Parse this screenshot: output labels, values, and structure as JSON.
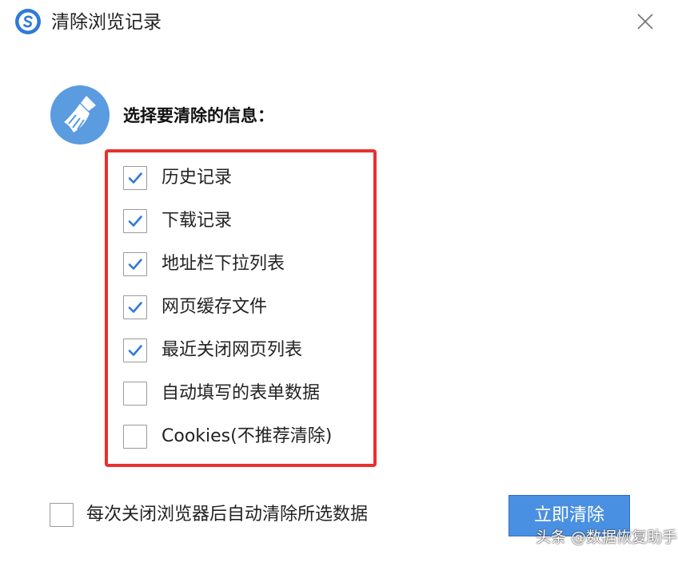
{
  "window": {
    "title": "清除浏览记录",
    "close_icon": "close-icon",
    "app_icon": "sogou-browser-logo"
  },
  "section": {
    "heading": "选择要清除的信息：",
    "icon": "broom-icon"
  },
  "options": [
    {
      "label": "历史记录",
      "checked": true
    },
    {
      "label": "下载记录",
      "checked": true
    },
    {
      "label": "地址栏下拉列表",
      "checked": true
    },
    {
      "label": "网页缓存文件",
      "checked": true
    },
    {
      "label": "最近关闭网页列表",
      "checked": true
    },
    {
      "label": "自动填写的表单数据",
      "checked": false
    },
    {
      "label": "Cookies(不推荐清除)",
      "checked": false
    }
  ],
  "auto_clear": {
    "label": "每次关闭浏览器后自动清除所选数据",
    "checked": false
  },
  "actions": {
    "clear_now_label": "立即清除"
  },
  "watermark": "头条 @数据恢复助手",
  "colors": {
    "accent_blue": "#4a90e2",
    "highlight_red": "#e8312f",
    "check_blue": "#2f7ad8",
    "icon_circle": "#5b9bdf"
  }
}
